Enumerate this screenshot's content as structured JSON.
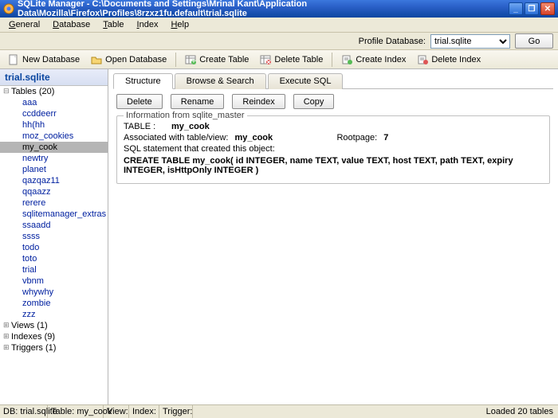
{
  "window": {
    "title": "SQLite Manager - C:\\Documents and Settings\\Mrinal Kant\\Application Data\\Mozilla\\Firefox\\Profiles\\8rzxz1fu.default\\trial.sqlite"
  },
  "menu": {
    "general": "General",
    "database": "Database",
    "table": "Table",
    "index": "Index",
    "help": "Help"
  },
  "profile": {
    "label": "Profile Database:",
    "selected": "trial.sqlite",
    "go": "Go"
  },
  "toolbar": {
    "new_db": "New Database",
    "open_db": "Open Database",
    "create_table": "Create Table",
    "delete_table": "Delete Table",
    "create_index": "Create Index",
    "delete_index": "Delete Index"
  },
  "sidebar": {
    "head": "trial.sqlite",
    "categories": {
      "tables": "Tables (20)",
      "views": "Views (1)",
      "indexes": "Indexes (9)",
      "triggers": "Triggers (1)"
    },
    "tables": [
      "aaa",
      "ccddeerr",
      "hh(hh",
      "moz_cookies",
      "my_cook",
      "newtry",
      "planet",
      "qazqaz11",
      "qqaazz",
      "rerere",
      "sqlitemanager_extras",
      "ssaadd",
      "ssss",
      "todo",
      "toto",
      "trial",
      "vbnm",
      "whywhy",
      "zombie",
      "zzz"
    ],
    "selected_table": "my_cook"
  },
  "tabs": {
    "structure": "Structure",
    "browse": "Browse & Search",
    "execute": "Execute SQL"
  },
  "actions": {
    "delete": "Delete",
    "rename": "Rename",
    "reindex": "Reindex",
    "copy": "Copy"
  },
  "info": {
    "legend": "Information from sqlite_master",
    "table_label": "TABLE   :",
    "table_value": "my_cook",
    "assoc_label": "Associated with table/view:",
    "assoc_value": "my_cook",
    "rootpage_label": "Rootpage:",
    "rootpage_value": "7",
    "sql_label": "SQL statement that created this object:",
    "sql": "CREATE TABLE my_cook( id INTEGER, name TEXT, value TEXT, host TEXT, path TEXT, expiry INTEGER, isHttpOnly INTEGER )"
  },
  "status": {
    "db": "DB: trial.sqlite",
    "table": "Table: my_cook",
    "view": "View:",
    "index": "Index:",
    "trigger": "Trigger:",
    "loaded": "Loaded 20 tables"
  }
}
